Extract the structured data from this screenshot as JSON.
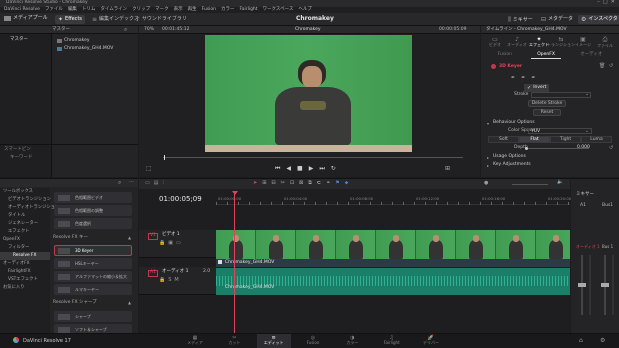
{
  "window": {
    "title": "DaVinci Resolve Studio - Chromakey"
  },
  "menubar": {
    "items": [
      "DaVinci Resolve",
      "ファイル",
      "編集",
      "トリム",
      "タイムライン",
      "クリップ",
      "マーク",
      "表示",
      "再生",
      "Fusion",
      "カラー",
      "Fairlight",
      "ワークスペース",
      "ヘルプ"
    ],
    "project_title": "Chromakey"
  },
  "toolbar": {
    "media_pool": "メディアプール",
    "effects": "Effects",
    "edit_index": "編集インデックス",
    "sound_library": "サウンドライブラリ",
    "mixer": "ミキサー",
    "metadata": "メタデータ",
    "inspector": "インスペクタ"
  },
  "viewer": {
    "zoom": "70%",
    "timecode_in": "00:01:45:12",
    "clip_name": "Chromakey",
    "timecode_out": "00:00:05:09"
  },
  "media": {
    "header": "マスター",
    "folder_label": "マスター",
    "items": [
      "Chromakey",
      "Chromakey_GH4.MOV"
    ]
  },
  "effects_panel": {
    "search_placeholder": "",
    "tree": [
      {
        "label": "ツールボックス",
        "indent": 0
      },
      {
        "label": "ビデオトランジション",
        "indent": 1
      },
      {
        "label": "オーディオトランジション",
        "indent": 1
      },
      {
        "label": "タイトル",
        "indent": 1
      },
      {
        "label": "ジェネレーター",
        "indent": 1
      },
      {
        "label": "エフェクト",
        "indent": 1
      },
      {
        "label": "OpenFX",
        "indent": 0
      },
      {
        "label": "フィルター",
        "indent": 1
      },
      {
        "label": "Resolve FX",
        "indent": 2
      },
      {
        "label": "オーディオFX",
        "indent": 0
      },
      {
        "label": "FairlightFX",
        "indent": 1
      },
      {
        "label": "VSTエフェクト",
        "indent": 1
      },
      {
        "label": "お気に入り",
        "indent": 0
      }
    ],
    "favorites_label": "お気に入り",
    "keywords_label": "キーワード",
    "sections_label_1": "Resolve FX キー",
    "items_top": [
      "色相範囲ビデオ",
      "色相範囲の調整",
      "色度選択"
    ],
    "items_key": [
      "3D Keyer",
      "HSLキーヤー",
      "アルファマットの縮小＆拡大",
      "ルマキーヤー"
    ],
    "sections_label_2": "Resolve FX シャープ",
    "items_sharp": [
      "シャープ",
      "ソフト＆シャープ"
    ]
  },
  "inspector": {
    "header": "タイムライン - Chromakey_GH4.MOV",
    "tabs": [
      "ビデオ",
      "オーディオ",
      "エフェクト",
      "トランジション",
      "イメージ",
      "ファイル"
    ],
    "subtabs": [
      "Fusion",
      "OpenFX",
      "オーディオ"
    ],
    "effect_name": "3D Keyer",
    "invert_label": "Invert",
    "stroke_label": "Stroke",
    "delete_stroke": "Delete Stroke",
    "reset": "Reset",
    "behaviour_section": "Behaviour Options",
    "color_space_label": "Color Space",
    "color_space_value": "YUV",
    "softness_options": [
      "Soft",
      "Flat",
      "Tight",
      "Luma"
    ],
    "depth_label": "Depth",
    "depth_value": "0.000",
    "usage_section": "Usage Options",
    "key_adjust_section": "Key Adjustments"
  },
  "timeline": {
    "timecode": "01:00:05;09",
    "ruler_labels": [
      "01:00:00:00",
      "01:00:04:00",
      "01:00:08:00",
      "01:00:12:00",
      "01:00:16:00",
      "01:00:20:00"
    ],
    "video_track": {
      "id": "V1",
      "name": "ビデオ 1"
    },
    "audio_track": {
      "id": "A1",
      "name": "オーディオ 1",
      "level": "2.0"
    },
    "video_clip": "Chromakey_GH4.MOV",
    "audio_clip": "Chromakey_GH4.MOV"
  },
  "mixer": {
    "header": "ミキサー",
    "channels": [
      "A1",
      "Bus1"
    ],
    "meter_label": "オーディオ 1",
    "bus_label": "Bus 1"
  },
  "pages": {
    "items": [
      "メディア",
      "カット",
      "エディット",
      "Fusion",
      "カラー",
      "Fairlight",
      "デリバー"
    ],
    "active": "エディット",
    "app_label": "DaVinci Resolve 17"
  }
}
